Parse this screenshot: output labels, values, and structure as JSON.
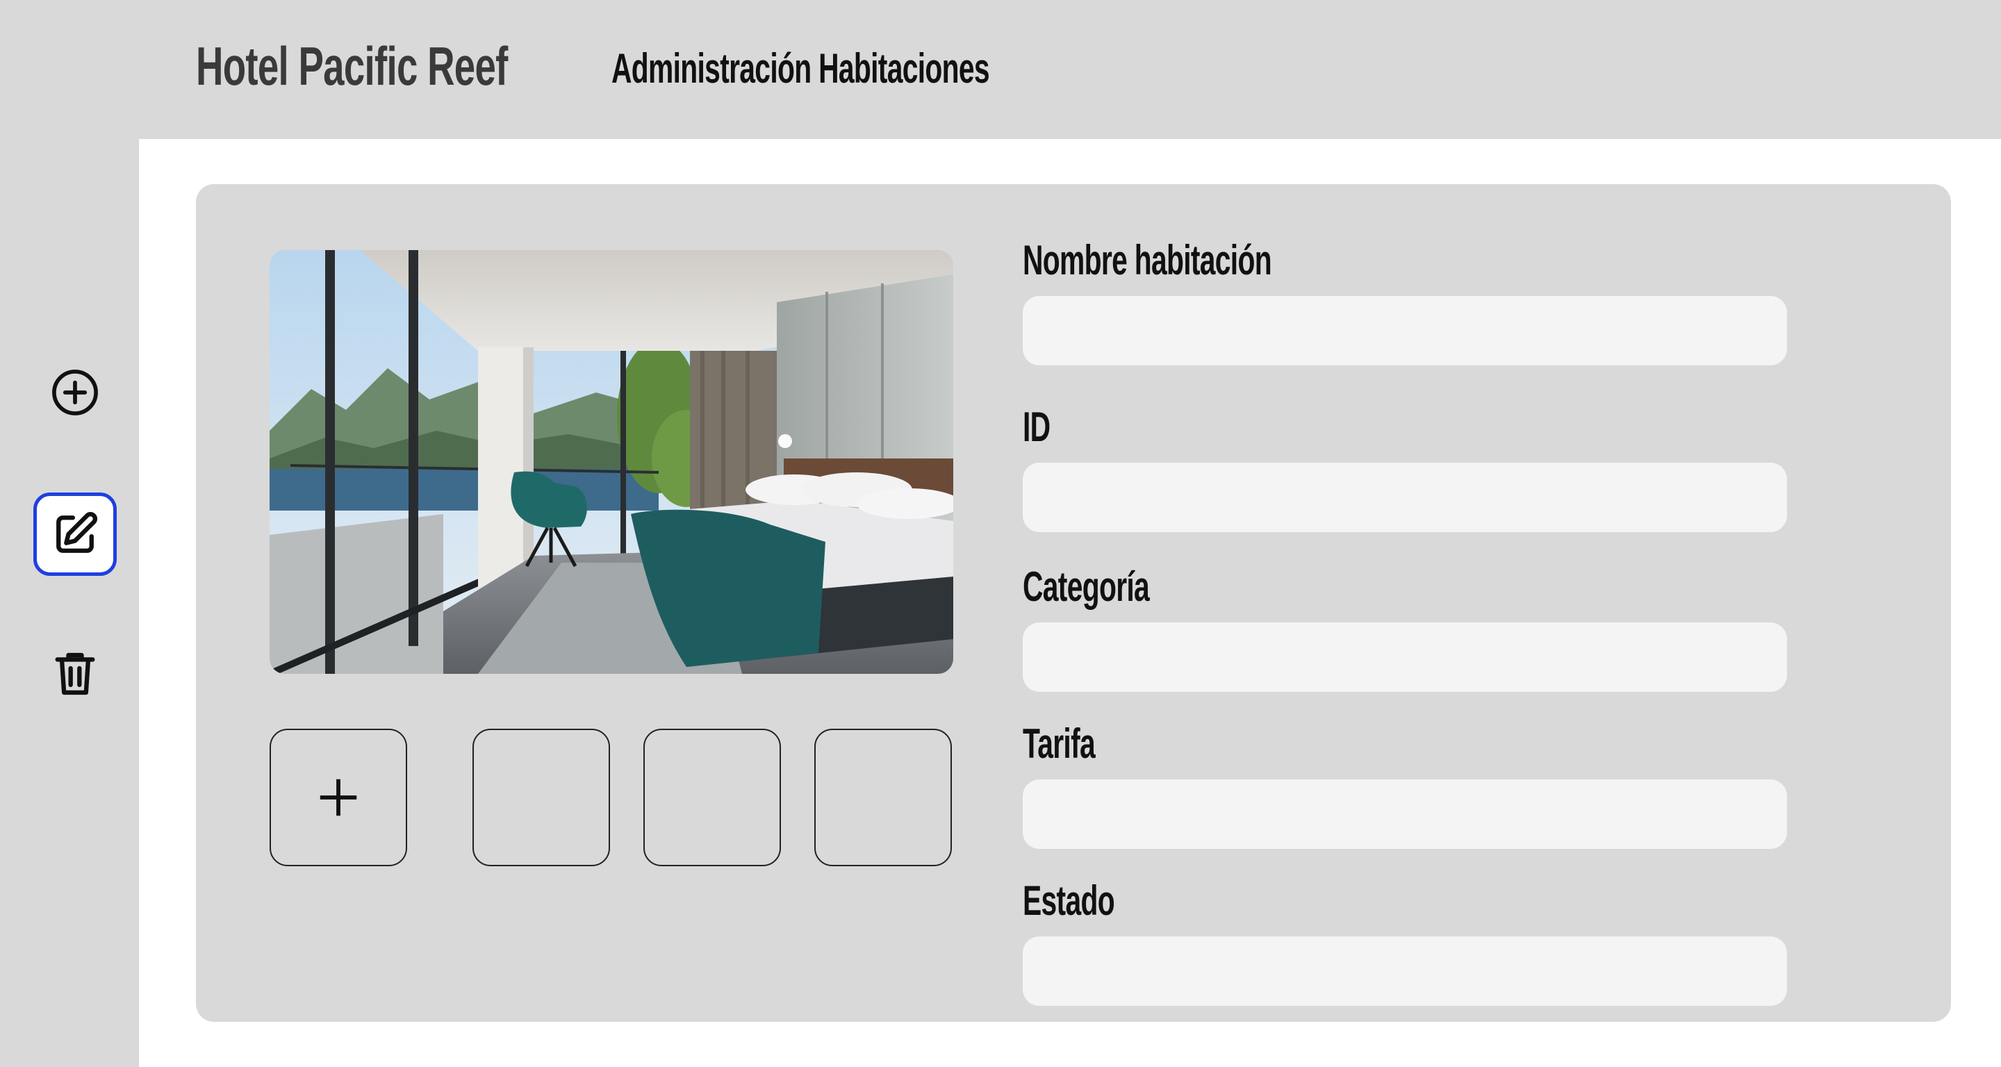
{
  "header": {
    "brand": "Hotel Pacific Reef",
    "title": "Administración Habitaciones"
  },
  "sidebar": {
    "tools": [
      {
        "icon": "plus-circle-icon",
        "active": false
      },
      {
        "icon": "edit-icon",
        "active": true
      },
      {
        "icon": "trash-icon",
        "active": false
      }
    ]
  },
  "gallery": {
    "main_photo": "bedroom-photo",
    "add_thumbnail_icon": "plus-icon",
    "empty_thumbnails": 3
  },
  "form": {
    "fields": [
      {
        "label": "Nombre habitación",
        "value": ""
      },
      {
        "label": "ID",
        "value": ""
      },
      {
        "label": "Categoría",
        "value": ""
      },
      {
        "label": "Tarifa",
        "value": ""
      },
      {
        "label": "Estado",
        "value": ""
      }
    ]
  },
  "colors": {
    "accent": "#1f3fe0",
    "panel": "#d9d9d9",
    "input": "#f4f4f4"
  }
}
